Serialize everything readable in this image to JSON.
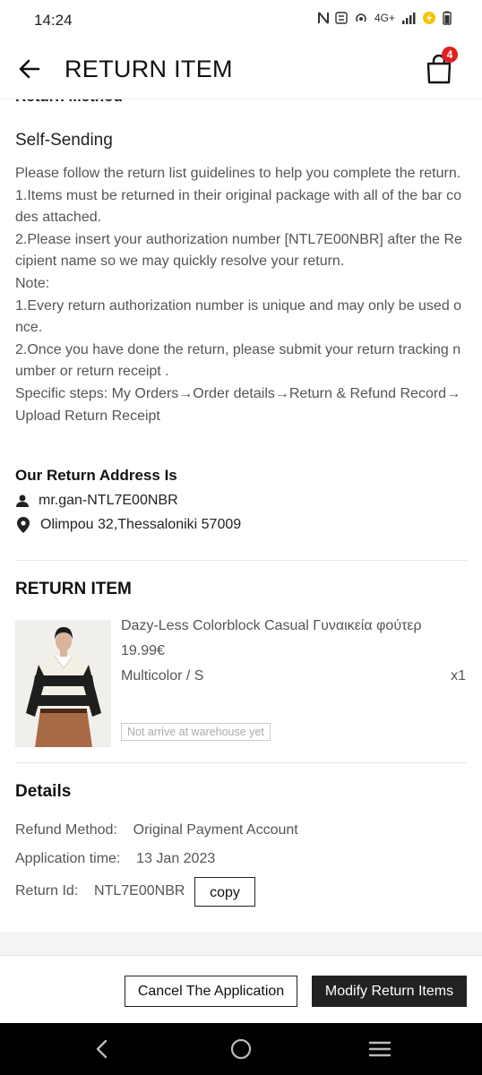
{
  "status_bar": {
    "time": "14:24",
    "network": "4G+"
  },
  "header": {
    "title": "RETURN ITEM",
    "cart_count": "4"
  },
  "return_method": {
    "section_heading": "Return Method",
    "method": "Self-Sending",
    "guidelines": [
      "Please follow the return list guidelines to help you complete the return.",
      "1.Items must be returned in their original package with all of the bar codes attached.",
      "2.Please insert your authorization number [NTL7E00NBR] after the Recipient name so we may quickly resolve your return.",
      "Note:",
      "1.Every return authorization number is unique and may only be used once.",
      "2.Once you have done the return, please submit your return tracking number or return receipt .",
      "Specific steps: My Orders→Order details→Return & Refund Record→Upload Return Receipt"
    ]
  },
  "address": {
    "title": "Our Return Address Is",
    "name": "mr.gan-NTL7E00NBR",
    "location": "Olimpou 32,Thessaloniki 57009"
  },
  "return_item": {
    "title": "RETURN ITEM",
    "product_name": "Dazy-Less Colorblock Casual Γυναικεία φούτερ",
    "price": "19.99€",
    "variant": "Multicolor / S",
    "quantity": "x1",
    "status": "Not arrive at warehouse yet"
  },
  "details": {
    "title": "Details",
    "refund_method_label": "Refund Method:",
    "refund_method_value": "Original Payment Account",
    "application_time_label": "Application time:",
    "application_time_value": "13 Jan 2023",
    "return_id_label": "Return Id:",
    "return_id_value": "NTL7E00NBR",
    "copy_label": "copy"
  },
  "actions": {
    "cancel_label": "Cancel The Application",
    "modify_label": "Modify Return Items"
  },
  "colors": {
    "accent": "#222222",
    "badge": "#e02020"
  }
}
